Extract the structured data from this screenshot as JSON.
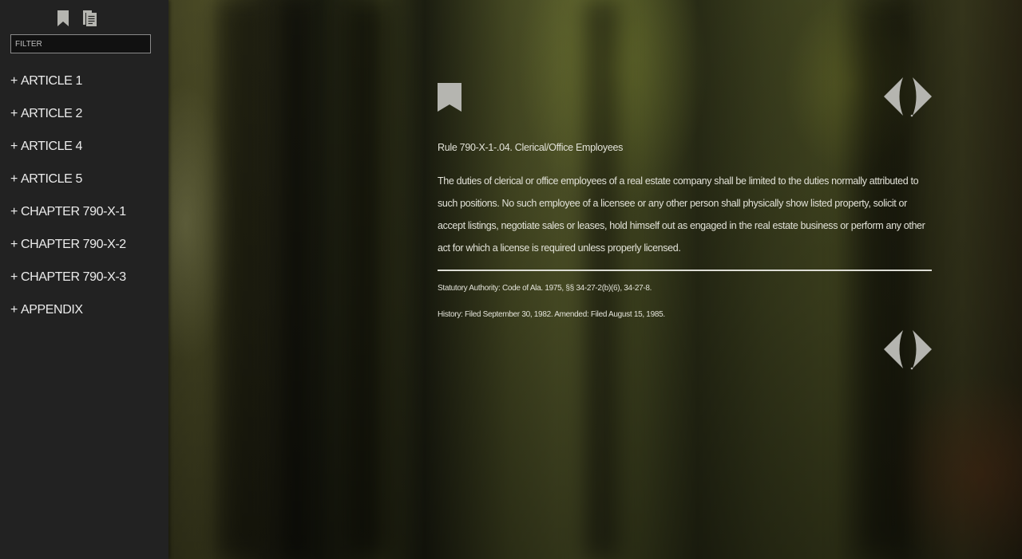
{
  "sidebar": {
    "filter_placeholder": "FILTER",
    "tools": [
      "bookmark-icon",
      "documents-icon"
    ],
    "items": [
      {
        "prefix": "+",
        "label": "ARTICLE 1"
      },
      {
        "prefix": "+",
        "label": "ARTICLE 2"
      },
      {
        "prefix": "+",
        "label": "ARTICLE 4"
      },
      {
        "prefix": "+",
        "label": "ARTICLE 5"
      },
      {
        "prefix": "+",
        "label": "CHAPTER 790-X-1"
      },
      {
        "prefix": "+",
        "label": "CHAPTER 790-X-2"
      },
      {
        "prefix": "+",
        "label": "CHAPTER 790-X-3"
      },
      {
        "prefix": "+",
        "label": "APPENDIX"
      }
    ]
  },
  "content": {
    "rule_title": "Rule 790-X-1-.04. Clerical/Office Employees",
    "rule_body": "The duties of clerical or office employees of a real estate company shall be limited to the duties normally attributed to such positions. No such employee of a licensee or any other person shall physically show listed property, solicit or accept listings, negotiate sales or leases, hold himself out as engaged in the real estate business or perform any other act for which a license is required unless properly licensed.",
    "statutory_authority": "Statutory Authority: Code of Ala. 1975, §§ 34-27-2(b)(6), 34-27-8.",
    "history": "History: Filed September 30, 1982. Amended: Filed August 15, 1985."
  },
  "colors": {
    "sidebar_bg": "#222222",
    "text": "#e2e2d8",
    "icon": "#b5b5b0"
  }
}
